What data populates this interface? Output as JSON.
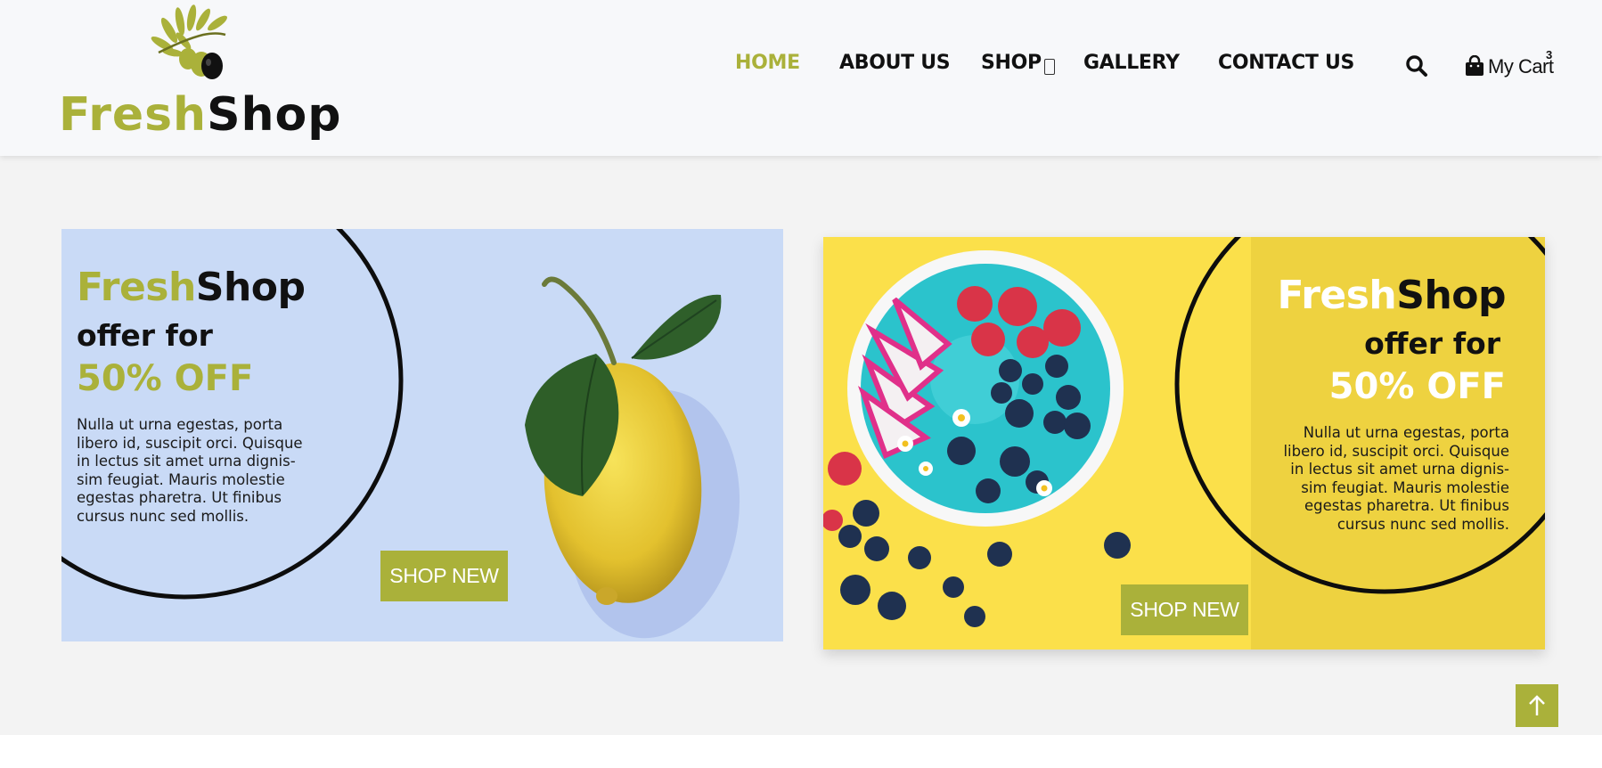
{
  "logo": {
    "fresh": "Fresh",
    "shop": "Shop"
  },
  "nav": {
    "items": [
      {
        "label": "HOME",
        "active": true
      },
      {
        "label": "ABOUT US",
        "active": false
      },
      {
        "label": "SHOP",
        "active": false
      },
      {
        "label": "GALLERY",
        "active": false
      },
      {
        "label": "CONTACT US",
        "active": false
      }
    ],
    "cart_label": "My Cart",
    "cart_count": "3"
  },
  "banners": [
    {
      "brand_fresh": "Fresh",
      "brand_shop": "Shop",
      "offer": "offer for",
      "discount": "50% OFF",
      "desc_lines": [
        "Nulla ut urna egestas, porta",
        "libero id, suscipit orci. Quisque",
        "in lectus sit amet urna dignis-",
        "sim feugiat. Mauris molestie",
        "egestas pharetra. Ut finibus",
        "cursus nunc sed mollis."
      ],
      "button": "SHOP NEW"
    },
    {
      "brand_fresh": "Fresh",
      "brand_shop": "Shop",
      "offer": "offer for",
      "discount": "50% OFF",
      "desc_lines": [
        "Nulla ut urna egestas, porta",
        "libero id, suscipit orci. Quisque",
        "in lectus sit amet urna dignis-",
        "sim feugiat. Mauris molestie",
        "egestas pharetra. Ut finibus",
        "cursus nunc sed mollis."
      ],
      "button": "SHOP NEW"
    }
  ],
  "colors": {
    "accent": "#aab13a",
    "banner1_bg": "#c9daf6",
    "banner2_bg": "#f6d84a",
    "text_dark": "#111111"
  },
  "icons": {
    "search": "search-icon",
    "cart": "shopping-bag-icon",
    "dropdown": "dropdown-caret-icon",
    "scroll_top": "arrow-up-icon"
  }
}
